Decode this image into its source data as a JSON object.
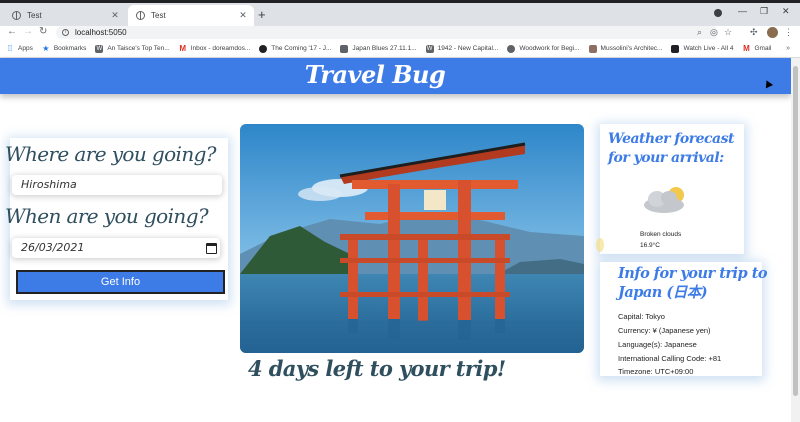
{
  "browser": {
    "tabs": [
      {
        "title": "Test",
        "active": false
      },
      {
        "title": "Test",
        "active": true
      }
    ],
    "new_tab": "+",
    "window_controls": [
      "—",
      "❐",
      "✕"
    ],
    "url": "localhost:5050",
    "bookmarks": [
      {
        "label": "Apps",
        "icon": "apps-grid-icon"
      },
      {
        "label": "Bookmarks",
        "icon": "star-icon"
      },
      {
        "label": "An Taisce's Top Ten...",
        "icon": "wordpress-icon"
      },
      {
        "label": "Inbox - doreamdos...",
        "icon": "gmail-icon"
      },
      {
        "label": "The Coming '17 - J...",
        "icon": "circle-icon"
      },
      {
        "label": "Japan Blues 27.11.1...",
        "icon": "page-icon"
      },
      {
        "label": "1942 - New Capital...",
        "icon": "wordpress-icon"
      },
      {
        "label": "Woodwork for Begi...",
        "icon": "site-icon"
      },
      {
        "label": "Mussolini's Architec...",
        "icon": "page-icon"
      },
      {
        "label": "Watch Live - All 4",
        "icon": "page-icon"
      },
      {
        "label": "Gmail",
        "icon": "gmail-icon"
      }
    ],
    "bookmarks_more": "»"
  },
  "app": {
    "title": "Travel Bug",
    "accent_color": "#3d7be6",
    "heading_color": "#2f4f5f"
  },
  "form": {
    "where_label": "Where are you going?",
    "where_value": "Hiroshima",
    "when_label": "When are you going?",
    "when_value": "26/03/2021",
    "submit_label": "Get Info"
  },
  "trip": {
    "image_subject": "Itsukushima torii gate in the sea",
    "countdown": "4 days left to your trip!"
  },
  "weather": {
    "heading": "Weather forecast for your arrival:",
    "icon": "partly-cloudy-icon",
    "description": "Broken clouds",
    "temperature": "16.9°C"
  },
  "country": {
    "heading": "Info for your trip to Japan (日本)",
    "capital": "Capital: Tokyo",
    "currency": "Currency: ¥ (Japanese yen)",
    "languages": "Language(s): Japanese",
    "calling_code": "International Calling Code: +81",
    "timezone": "Timezone: UTC+09:00"
  }
}
